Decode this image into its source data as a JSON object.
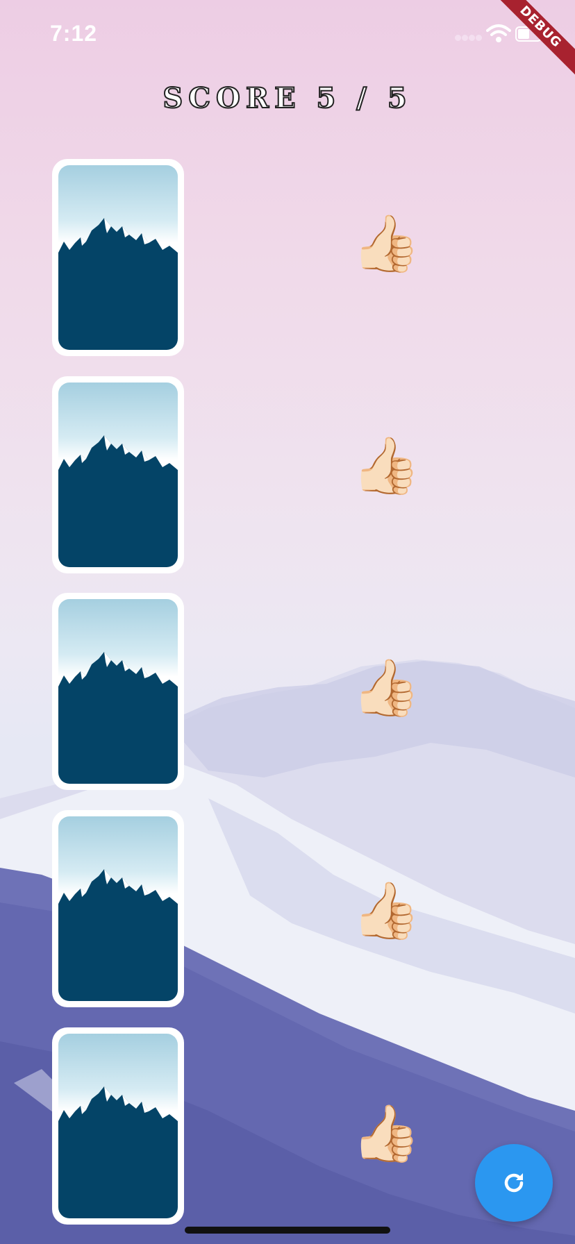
{
  "status_bar": {
    "time": "7:12",
    "debug_banner": "DEBUG"
  },
  "header": {
    "score_label": "SCORE 5 / 5"
  },
  "cards": [
    {
      "icon": "mountain-card-back",
      "result_icon": "thumbs-up-icon",
      "result_glyph": "👍🏻"
    },
    {
      "icon": "mountain-card-back",
      "result_icon": "thumbs-up-icon",
      "result_glyph": "👍🏻"
    },
    {
      "icon": "mountain-card-back",
      "result_icon": "thumbs-up-icon",
      "result_glyph": "👍🏻"
    },
    {
      "icon": "mountain-card-back",
      "result_icon": "thumbs-up-icon",
      "result_glyph": "👍🏻"
    },
    {
      "icon": "mountain-card-back",
      "result_icon": "thumbs-up-icon",
      "result_glyph": "👍🏻"
    }
  ],
  "fab": {
    "icon": "refresh-icon",
    "color": "#2b97f0"
  },
  "colors": {
    "card_mountain": "#044467",
    "debug_banner": "#a8222f",
    "background_top": "#edcde4"
  }
}
